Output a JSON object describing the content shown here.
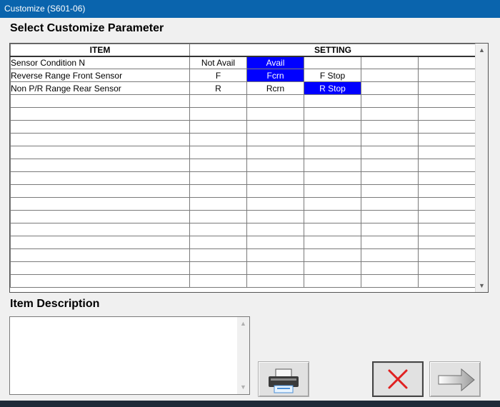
{
  "window": {
    "title": "Customize (S601-06)"
  },
  "heading": "Select Customize Parameter",
  "table": {
    "headers": [
      "ITEM",
      "SETTING"
    ],
    "rows": [
      {
        "item": "Sensor Condition N",
        "settings": [
          "Not Avail",
          "Avail",
          "",
          "",
          ""
        ],
        "selected": 1
      },
      {
        "item": "Reverse Range Front Sensor",
        "settings": [
          "F",
          "Fcrn",
          "F Stop",
          "",
          ""
        ],
        "selected": 1
      },
      {
        "item": "Non P/R Range Rear Sensor",
        "settings": [
          "R",
          "Rcrn",
          "R Stop",
          "",
          ""
        ],
        "selected": 2
      }
    ],
    "empty_rows": 15
  },
  "description": {
    "heading": "Item Description",
    "text": ""
  },
  "buttons": {
    "print": "printer-icon",
    "cancel": "red-x-icon",
    "next": "right-arrow-icon"
  },
  "colors": {
    "titlebar": "#0a64ad",
    "selection": "#0000ff",
    "cancel_x": "#e02020"
  }
}
